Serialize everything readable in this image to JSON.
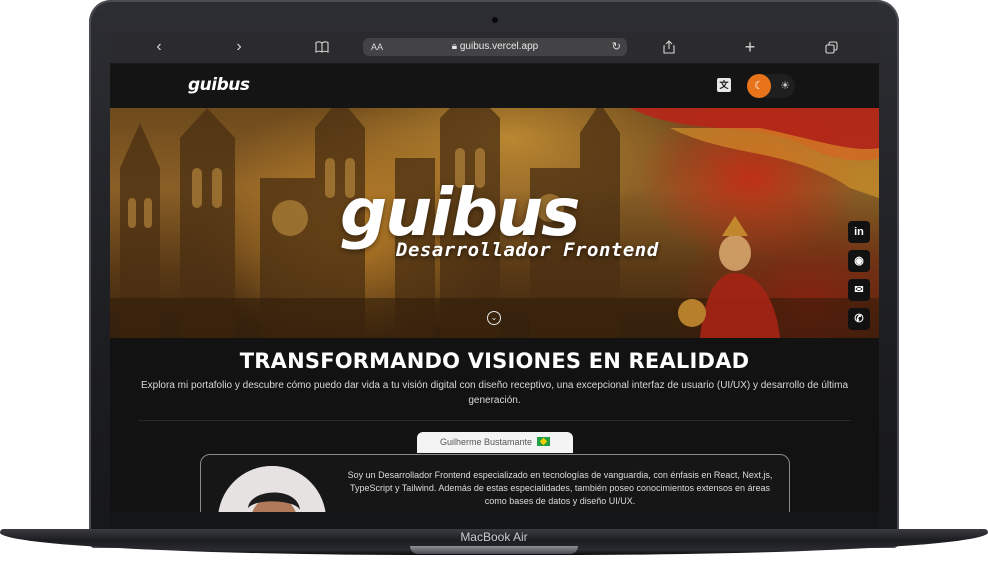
{
  "device": {
    "label": "MacBook Air"
  },
  "browser": {
    "back_icon": "chevron-left-icon",
    "forward_icon": "chevron-right-icon",
    "reader_icon": "book-icon",
    "text_size_label": "AA",
    "url": "guibus.vercel.app",
    "lock_icon": "lock-icon",
    "reload_icon": "reload-icon",
    "share_icon": "share-icon",
    "new_tab_icon": "plus-icon",
    "tabs_icon": "tabs-icon"
  },
  "navbar": {
    "logo": "guibus",
    "translate_icon": "translate-icon",
    "theme": {
      "active": "dark",
      "moon_icon": "moon-icon",
      "sun_icon": "sun-icon",
      "accent": "#e8731a"
    }
  },
  "hero": {
    "title": "guibus",
    "subtitle": "Desarrollador Frontend",
    "scroll_icon": "chevron-down-circle-icon"
  },
  "social": [
    {
      "name": "linkedin",
      "glyph": "in"
    },
    {
      "name": "github",
      "glyph": "◉"
    },
    {
      "name": "contact",
      "glyph": "✉"
    },
    {
      "name": "whatsapp",
      "glyph": "✆"
    }
  ],
  "section": {
    "headline": "TRANSFORMANDO VISIONES EN REALIDAD",
    "lead": "Explora mi portafolio y descubre cómo puedo dar vida a tu visión digital con diseño receptivo, una excepcional interfaz de usuario (UI/UX) y desarrollo de última generación."
  },
  "profile": {
    "name": "Guilherme Bustamante",
    "bio": "Soy un Desarrollador Frontend especializado en tecnologías de vanguardia, con énfasis en React, Next.js, TypeScript y Tailwind. Además de estas especialidades, también poseo conocimientos extensos en áreas como bases de datos y diseño UI/UX."
  }
}
